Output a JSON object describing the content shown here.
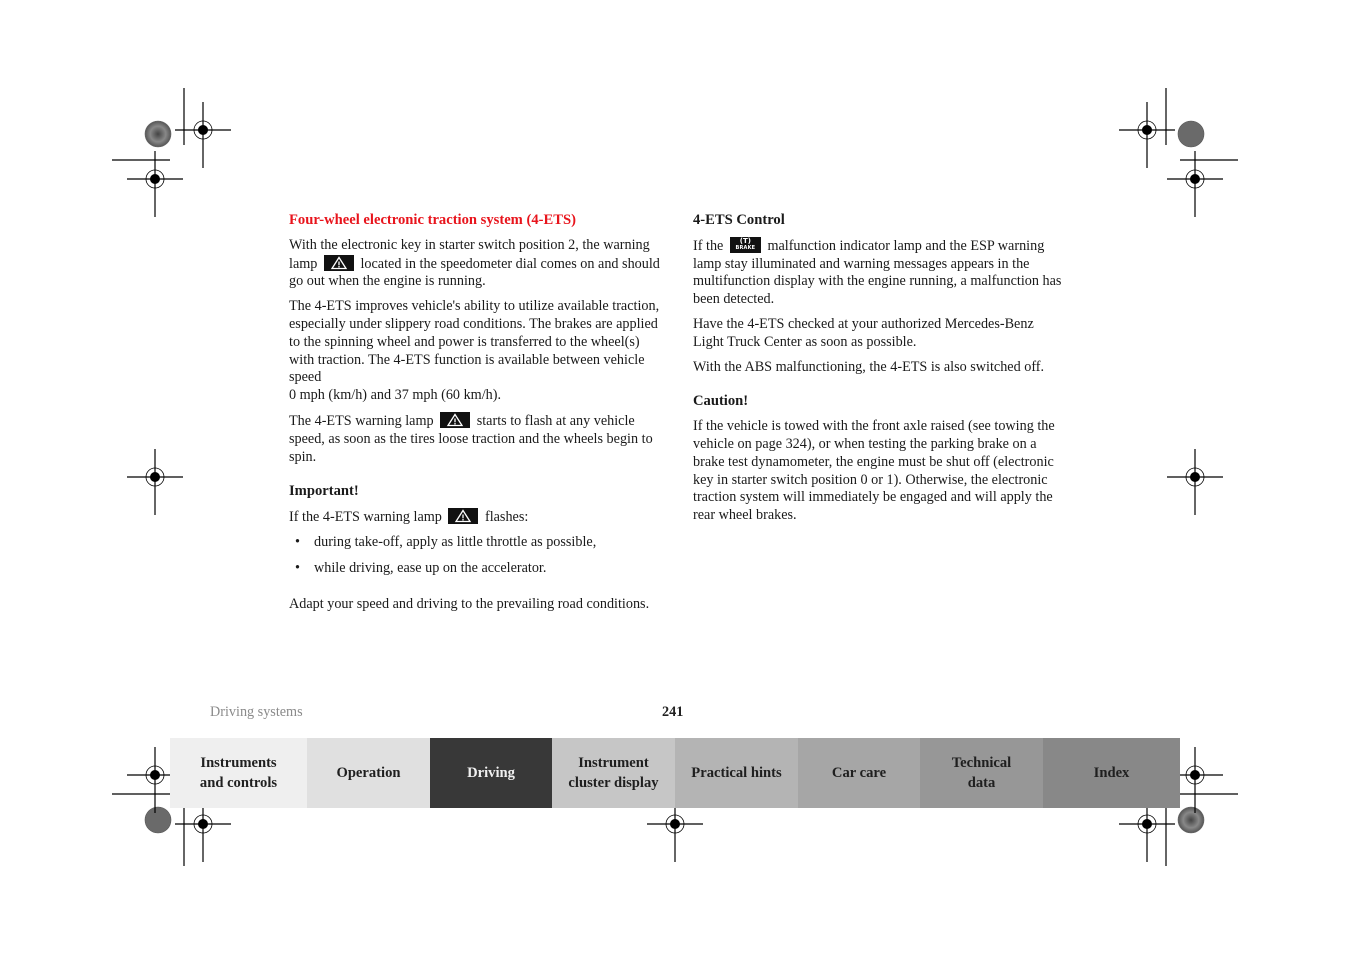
{
  "left_column": {
    "title": "Four-wheel electronic traction system (4-ETS)",
    "p1_before_icon": "With the electronic key in starter switch position 2, the warning lamp",
    "p1_after_icon": "located in the speedometer dial comes on and should go out when the engine is running.",
    "p2": "The 4-ETS improves vehicle's ability to utilize available traction, especially under slippery road conditions. The brakes are applied to the spinning wheel and power is transferred to the wheel(s) with traction. The 4-ETS function is available between vehicle speed",
    "p2_line2": "0 mph (km/h) and 37 mph (60 km/h).",
    "p3_before_icon": "The 4-ETS warning lamp",
    "p3_after_icon": "starts to flash at any vehicle speed, as soon as the tires loose traction and the wheels begin to spin.",
    "important_heading": "Important!",
    "important_before_icon": "If the 4-ETS warning lamp",
    "important_after_icon": "flashes:",
    "bullets": [
      "during take-off, apply as little throttle as possible,",
      "while driving, ease up on the accelerator."
    ],
    "bullet_glyph": "•",
    "closing": "Adapt your speed and driving to the prevailing road conditions."
  },
  "right_column": {
    "title": "4-ETS Control",
    "p1_before_icon": "If the",
    "p1_after_icon": "malfunction indicator lamp and the ESP warning lamp stay illuminated and warning messages appears in the multifunction display with the engine running, a malfunction has been detected.",
    "p2": "Have the 4-ETS checked at your authorized Mercedes-Benz Light Truck Center as soon as possible.",
    "p3": "With the ABS malfunctioning, the 4-ETS is also switched off.",
    "caution_heading": "Caution!",
    "caution_text": "If the vehicle is towed with the front axle raised (see towing the vehicle on page 324), or when testing the parking brake on a brake test dynamometer, the engine must be shut off (electronic key in starter switch position 0 or 1). Otherwise, the electronic traction system will immediately be engaged and will apply the rear wheel brakes."
  },
  "icons": {
    "warning_lamp": "warning-triangle-icon",
    "brake_lamp_top": "(T)",
    "brake_lamp_label": "BRAKE"
  },
  "footer": {
    "section": "Driving systems",
    "page_number": "241"
  },
  "tabs": [
    {
      "label": "Instruments\nand controls",
      "bg": "#efefef"
    },
    {
      "label": "Operation",
      "bg": "#e0e0e0"
    },
    {
      "label": "Driving",
      "bg": "#383838",
      "active": true
    },
    {
      "label": "Instrument\ncluster display",
      "bg": "#c6c6c6"
    },
    {
      "label": "Practical hints",
      "bg": "#b4b4b4"
    },
    {
      "label": "Car care",
      "bg": "#a6a6a6"
    },
    {
      "label": "Technical\ndata",
      "bg": "#979797"
    },
    {
      "label": "Index",
      "bg": "#888888"
    }
  ]
}
